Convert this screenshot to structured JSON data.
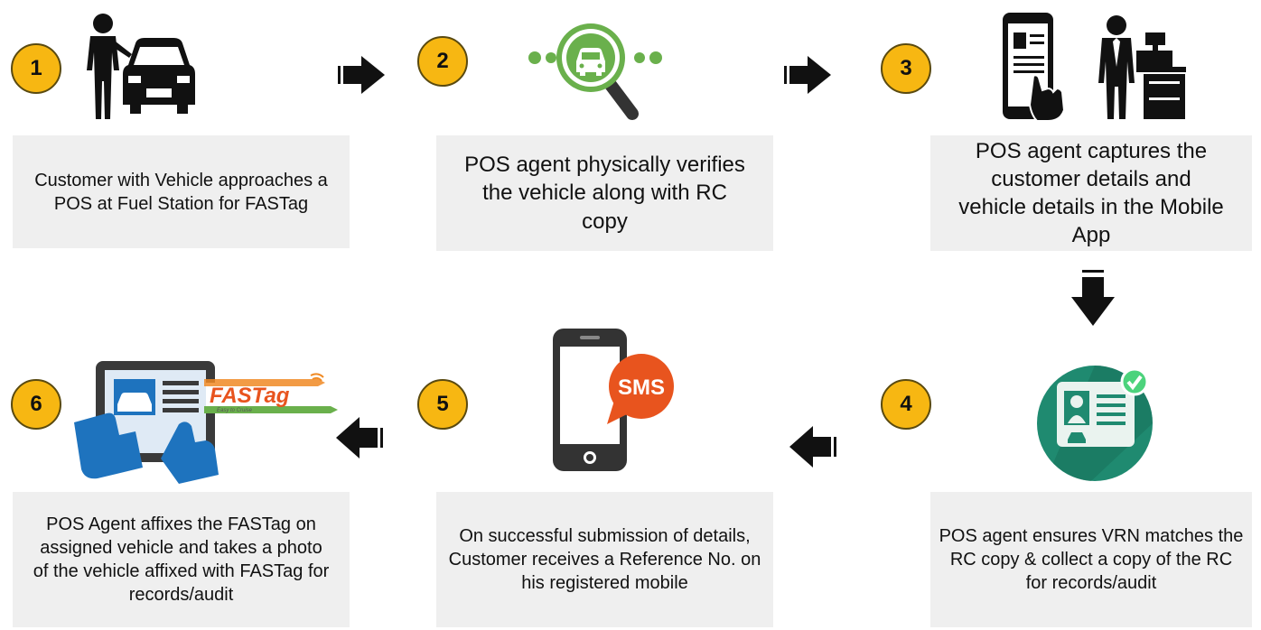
{
  "steps": [
    {
      "number": "1",
      "text": "Customer with Vehicle approaches a POS at Fuel Station for FASTag",
      "icon": "person-with-car-icon"
    },
    {
      "number": "2",
      "text": "POS agent physically verifies the vehicle along with RC copy",
      "icon": "vehicle-magnifier-icon"
    },
    {
      "number": "3",
      "text": "POS agent  captures the customer details and vehicle details in the Mobile App",
      "icon": "mobile-app-agent-icon"
    },
    {
      "number": "4",
      "text": "POS agent  ensures VRN matches the RC copy & collect a copy of the RC for records/audit",
      "icon": "rc-card-verified-icon"
    },
    {
      "number": "5",
      "text": "On successful submission of details, Customer receives a Reference No. on his registered mobile",
      "icon": "sms-phone-icon"
    },
    {
      "number": "6",
      "text": "POS Agent affixes the FASTag on assigned vehicle and takes a photo of the vehicle affixed with FASTag for records/audit",
      "icon": "tablet-photo-icon"
    }
  ],
  "logo": {
    "text": "FASTag",
    "tagline": "Easy to Cruise"
  },
  "sms_label": "SMS",
  "colors": {
    "badge": "#f7b712",
    "box": "#efefef",
    "green": "#6ab04c",
    "teal": "#1f8a70",
    "blue": "#1e73be",
    "sms": "#e8541e"
  }
}
